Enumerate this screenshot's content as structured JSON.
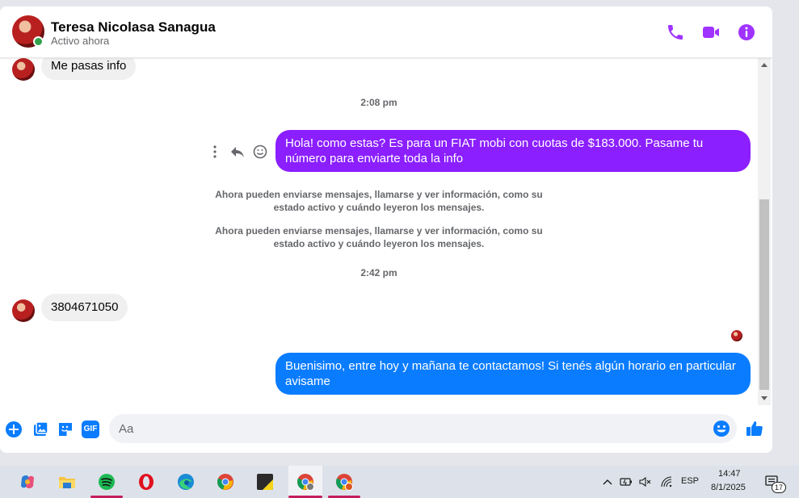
{
  "header": {
    "contact_name": "Teresa Nicolasa Sanagua",
    "status": "Activo ahora",
    "accent_color": "#a033ff",
    "icons": [
      "phone-icon",
      "video-call-icon",
      "info-icon"
    ]
  },
  "messages": {
    "incoming_1": "Me pasas info",
    "timestamp_1": "2:08 pm",
    "outgoing_1": "Hola! como estas? Es para un FIAT mobi con cuotas de $183.000. Pasame tu número para enviarte toda la info",
    "outgoing_1_color": "#8b1fff",
    "system_1": "Ahora pueden enviarse mensajes, llamarse y ver información, como su estado activo y cuándo leyeron los mensajes.",
    "system_2": "Ahora pueden enviarse mensajes, llamarse y ver información, como su estado activo y cuándo leyeron los mensajes.",
    "timestamp_2": "2:42 pm",
    "incoming_2": "3804671050",
    "outgoing_2": "Buenisimo, entre hoy y mañana te contactamos! Si tenés algún horario en particular avisame",
    "outgoing_2_color": "#0a7cff"
  },
  "composer": {
    "placeholder": "Aa",
    "value": "",
    "icons": [
      "plus-icon",
      "photo-icon",
      "sticker-icon",
      "gif-icon",
      "emoji-icon",
      "thumbs-up-icon"
    ],
    "gif_label": "GIF"
  },
  "taskbar": {
    "apps": [
      "copilot",
      "file-explorer",
      "spotify",
      "opera",
      "edge",
      "chrome",
      "sticky-notes",
      "chrome-profile-1",
      "chrome-profile-2"
    ],
    "language": "ESP",
    "time": "14:47",
    "date": "8/1/2025",
    "notification_count": "17"
  }
}
